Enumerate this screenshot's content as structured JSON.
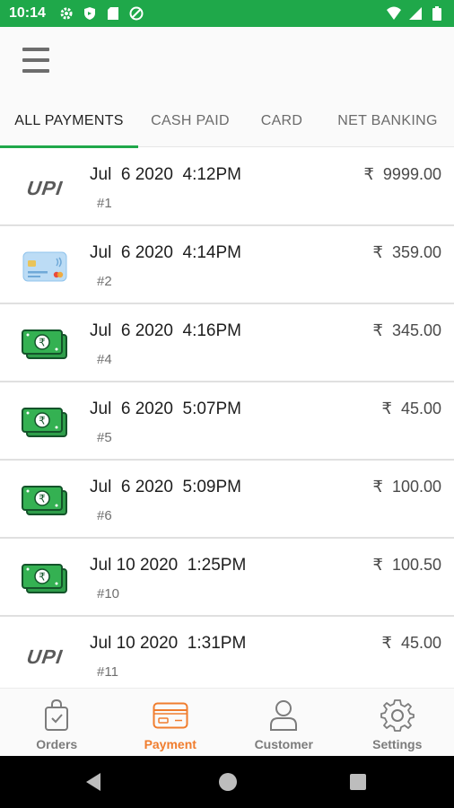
{
  "status_bar": {
    "time": "10:14",
    "left_icons": [
      "gear-icon",
      "shield-icon",
      "sd-card-icon",
      "at-sign-icon"
    ],
    "right_icons": [
      "wifi-icon",
      "signal-icon",
      "battery-icon"
    ]
  },
  "app_bar": {
    "menu_icon": "hamburger-menu-icon"
  },
  "tabs": [
    {
      "label": "ALL PAYMENTS",
      "active": true
    },
    {
      "label": "CASH PAID",
      "active": false
    },
    {
      "label": "CARD",
      "active": false
    },
    {
      "label": "NET BANKING",
      "active": false
    }
  ],
  "payments": [
    {
      "method": "upi",
      "method_label": "UPI",
      "date": "Jul  6 2020  4:12PM",
      "order": "#1",
      "amount": "₹  9999.00"
    },
    {
      "method": "card",
      "method_label": "",
      "date": "Jul  6 2020  4:14PM",
      "order": "#2",
      "amount": "₹  359.00"
    },
    {
      "method": "cash",
      "method_label": "",
      "date": "Jul  6 2020  4:16PM",
      "order": "#4",
      "amount": "₹  345.00"
    },
    {
      "method": "cash",
      "method_label": "",
      "date": "Jul  6 2020  5:07PM",
      "order": "#5",
      "amount": "₹  45.00"
    },
    {
      "method": "cash",
      "method_label": "",
      "date": "Jul  6 2020  5:09PM",
      "order": "#6",
      "amount": "₹  100.00"
    },
    {
      "method": "cash",
      "method_label": "",
      "date": "Jul 10 2020  1:25PM",
      "order": "#10",
      "amount": "₹  100.50"
    },
    {
      "method": "upi",
      "method_label": "UPI",
      "date": "Jul 10 2020  1:31PM",
      "order": "#11",
      "amount": "₹  45.00"
    }
  ],
  "bottom_nav": [
    {
      "label": "Orders",
      "icon": "shopping-bag-icon",
      "active": false
    },
    {
      "label": "Payment",
      "icon": "credit-card-icon",
      "active": true
    },
    {
      "label": "Customer",
      "icon": "person-icon",
      "active": false
    },
    {
      "label": "Settings",
      "icon": "gear-icon",
      "active": false
    }
  ],
  "colors": {
    "status_bar": "#1fa84a",
    "tab_indicator": "#1fa84a",
    "nav_active": "#f07d2e",
    "cash_icon": "#2e9e4a"
  }
}
